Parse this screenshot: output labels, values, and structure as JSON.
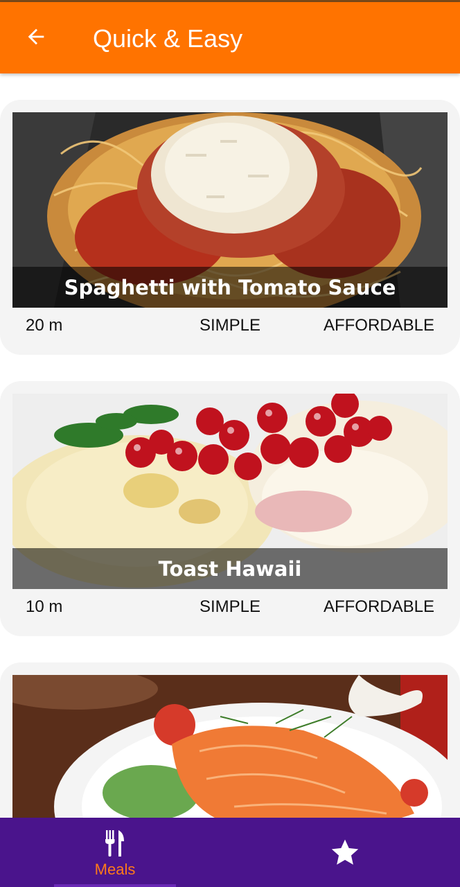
{
  "app_bar": {
    "title": "Quick & Easy",
    "background": "#ff7300",
    "back_icon": "arrow-left-icon"
  },
  "meals": [
    {
      "title": "Spaghetti with Tomato Sauce",
      "duration": "20 m",
      "complexity": "SIMPLE",
      "affordability": "AFFORDABLE"
    },
    {
      "title": "Toast Hawaii",
      "duration": "10 m",
      "complexity": "SIMPLE",
      "affordability": "AFFORDABLE"
    },
    {
      "title": "",
      "duration": "",
      "complexity": "",
      "affordability": ""
    }
  ],
  "bottom_nav": {
    "background": "#4a148c",
    "active_color": "#ff7a1a",
    "items": [
      {
        "label": "Meals",
        "icon": "fork-knife-icon",
        "active": true
      },
      {
        "label": "",
        "icon": "star-icon",
        "active": false
      }
    ]
  }
}
